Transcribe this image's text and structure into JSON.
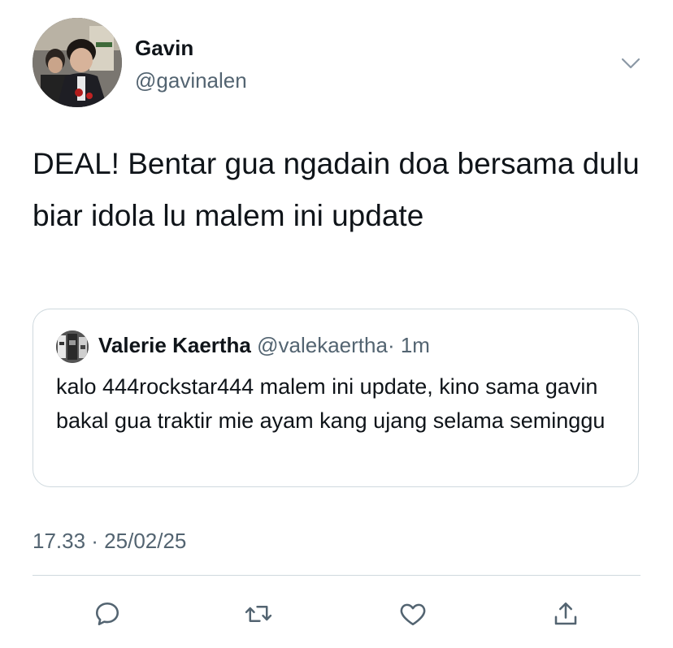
{
  "author": {
    "name": "Gavin",
    "handle": "@gavinalen",
    "avatar_icon": "profile-photo"
  },
  "tweet": {
    "text": "DEAL! Bentar gua ngadain doa bersama dulu biar idola lu malem ini update",
    "timestamp": "17.33 · 25/02/25"
  },
  "quote": {
    "name": "Valerie Kaertha",
    "handle": "@valekaertha",
    "time": "· 1m",
    "text": "kalo 444rockstar444 malem ini update, kino sama gavin bakal gua traktir mie ayam kang ujang selama seminggu"
  },
  "actions": [
    {
      "icon": "reply-icon"
    },
    {
      "icon": "retweet-icon"
    },
    {
      "icon": "like-icon"
    },
    {
      "icon": "share-icon"
    }
  ],
  "colors": {
    "text_primary": "#0f1419",
    "text_secondary": "#536471",
    "border": "#cfd9de"
  }
}
